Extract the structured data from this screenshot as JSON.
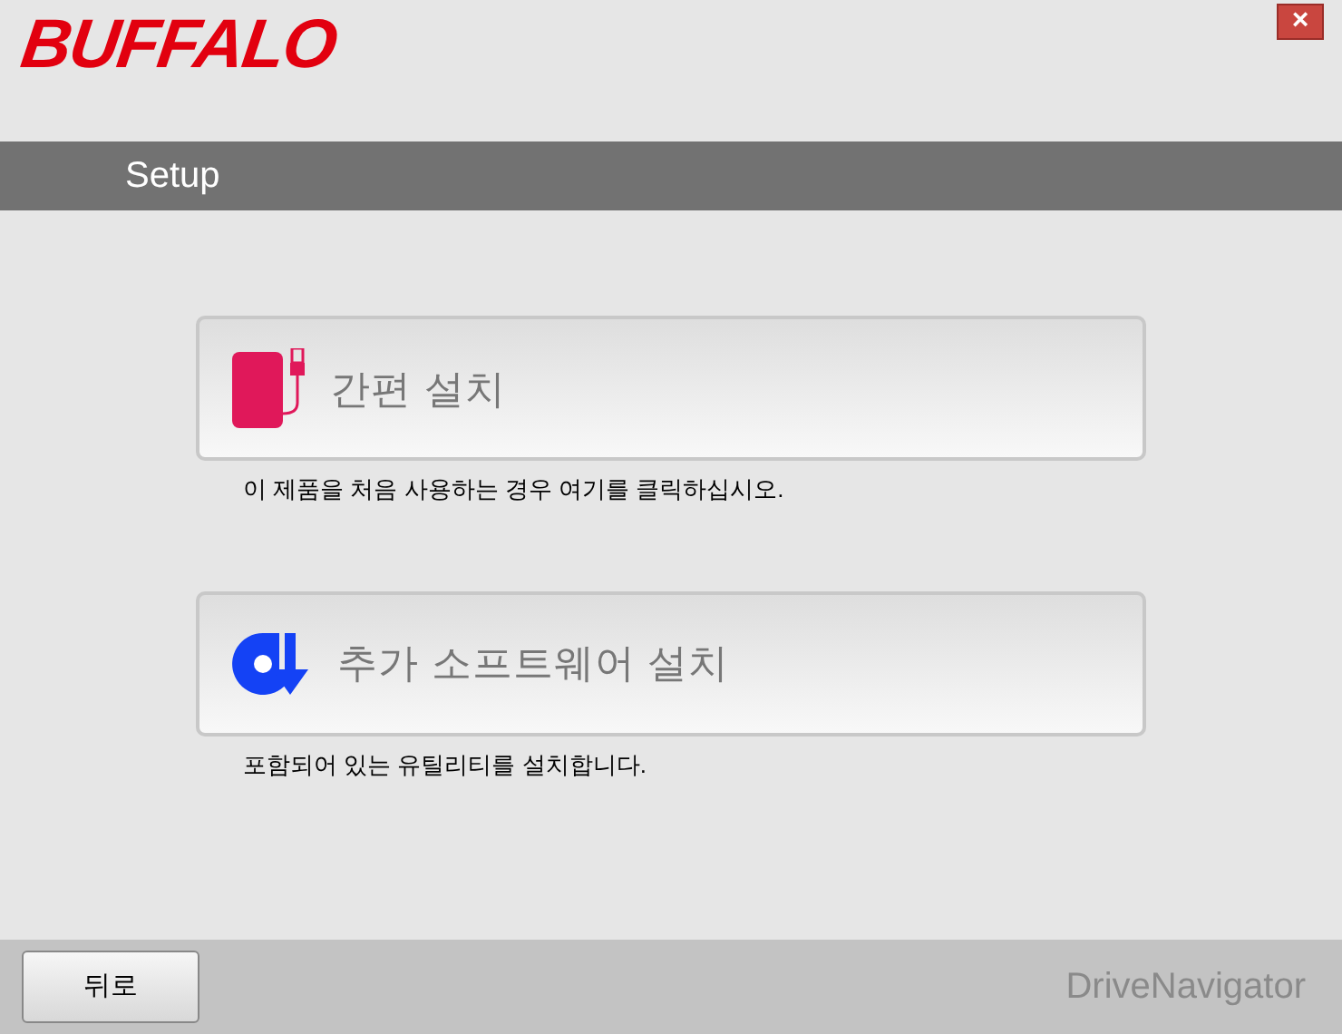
{
  "logo": "BUFFALO",
  "close_button": "×",
  "section_title": "Setup",
  "options": [
    {
      "kind": "drive",
      "label": "간편 설치",
      "description": "이 제품을 처음 사용하는 경우 여기를 클릭하십시오."
    },
    {
      "kind": "download",
      "label": "추가 소프트웨어 설치",
      "description": "포함되어 있는 유틸리티를 설치합니다."
    }
  ],
  "back_button": "뒤로",
  "app_name": "DriveNavigator"
}
